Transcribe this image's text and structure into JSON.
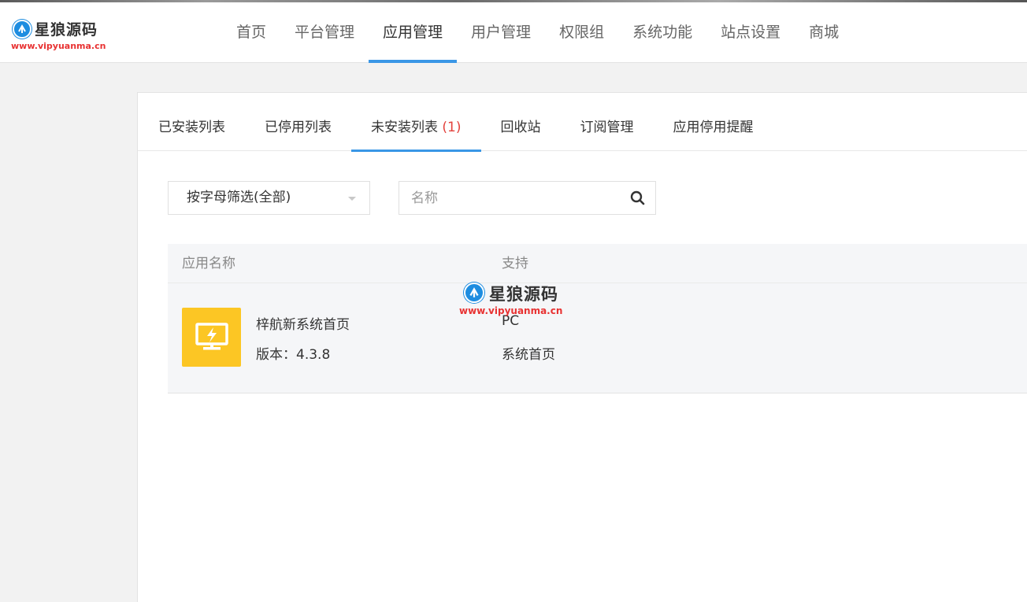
{
  "brand": {
    "name": "星狼源码",
    "url": "www.vipyuanma.cn"
  },
  "nav": {
    "items": [
      {
        "label": "首页"
      },
      {
        "label": "平台管理"
      },
      {
        "label": "应用管理"
      },
      {
        "label": "用户管理"
      },
      {
        "label": "权限组"
      },
      {
        "label": "系统功能"
      },
      {
        "label": "站点设置"
      },
      {
        "label": "商城"
      }
    ],
    "active": "应用管理"
  },
  "tabs": {
    "items": [
      {
        "label": "已安装列表"
      },
      {
        "label": "已停用列表"
      },
      {
        "label": "未安装列表",
        "count": "(1)"
      },
      {
        "label": "回收站"
      },
      {
        "label": "订阅管理"
      },
      {
        "label": "应用停用提醒"
      }
    ],
    "active": "未安装列表"
  },
  "filter": {
    "selected": "按字母筛选(全部)"
  },
  "search": {
    "placeholder": "名称",
    "value": ""
  },
  "table": {
    "headers": {
      "name": "应用名称",
      "support": "支持"
    },
    "rows": [
      {
        "name": "梓航新系统首页",
        "version": "版本：4.3.8",
        "support_platform": "PC",
        "support_type": "系统首页",
        "icon": "monitor-lightning-icon"
      }
    ]
  },
  "colors": {
    "accent": "#3a97e6",
    "app_icon_bg": "#fcc624",
    "count": "#e3423d",
    "brand_url": "#e83232"
  }
}
